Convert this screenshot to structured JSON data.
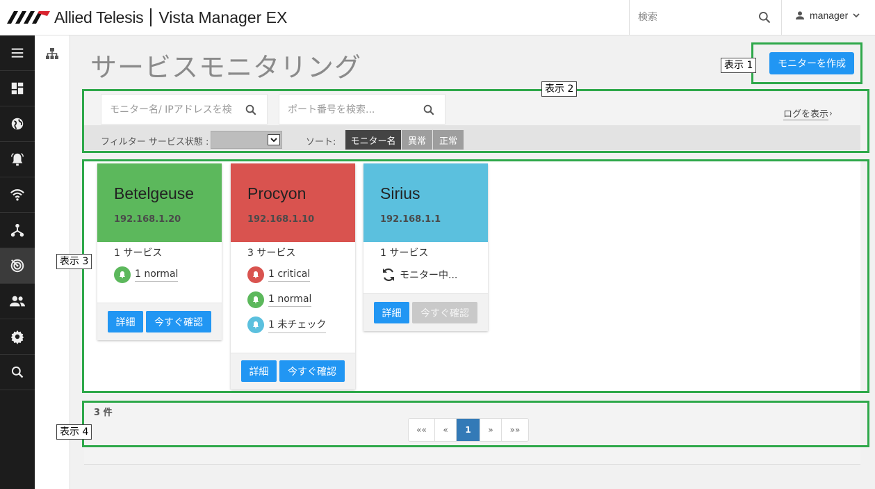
{
  "header": {
    "brand": "Allied Telesis",
    "product": "Vista Manager EX",
    "search_placeholder": "検索",
    "user": "manager"
  },
  "leftnav": {
    "items": [
      "menu-icon",
      "dashboard-icon",
      "globe-icon",
      "alarm-icon",
      "wifi-icon",
      "topology-icon",
      "monitoring-icon",
      "users-icon",
      "settings-icon",
      "search-icon"
    ],
    "active_index": 6
  },
  "page": {
    "title": "サービスモニタリング",
    "create_button": "モニターを作成"
  },
  "callouts": [
    "表示 1",
    "表示 2",
    "表示 3",
    "表示 4"
  ],
  "filters": {
    "monitor_search_placeholder": "モニター名/ IPアドレスを検",
    "port_search_placeholder": "ポート番号を検索...",
    "log_link": "ログを表示",
    "filter_label": "フィルター サービス状態 :",
    "sort_label": "ソート:",
    "sort_buttons": [
      "モニター名",
      "異常",
      "正常"
    ],
    "active_sort": "モニター名"
  },
  "cards": [
    {
      "name": "Betelgeuse",
      "ip": "192.168.1.20",
      "color": "#5cb85c",
      "services": "1 サービス",
      "statuses": [
        {
          "label": "1 normal",
          "color": "#5cb85c"
        }
      ],
      "details_button": "詳細",
      "check_button": "今すぐ確認"
    },
    {
      "name": "Procyon",
      "ip": "192.168.1.10",
      "color": "#d9534f",
      "services": "3 サービス",
      "statuses": [
        {
          "label": "1 critical",
          "color": "#d9534f"
        },
        {
          "label": "1 normal",
          "color": "#5cb85c"
        },
        {
          "label": "1 未チェック",
          "color": "#5bc0de"
        }
      ],
      "details_button": "詳細",
      "check_button": "今すぐ確認"
    },
    {
      "name": "Sirius",
      "ip": "192.168.1.1",
      "color": "#5bc0de",
      "services": "1 サービス",
      "monitoring_text": "モニター中...",
      "details_button": "詳細",
      "check_button": "今すぐ確認"
    }
  ],
  "pagination": {
    "count": "3 件",
    "buttons": [
      "««",
      "«",
      "1",
      "»",
      "»»"
    ],
    "current": "1"
  },
  "colors": {
    "primary": "#2196f3",
    "highlight": "#2ea84a",
    "sidebar": "#1c1c1c"
  }
}
